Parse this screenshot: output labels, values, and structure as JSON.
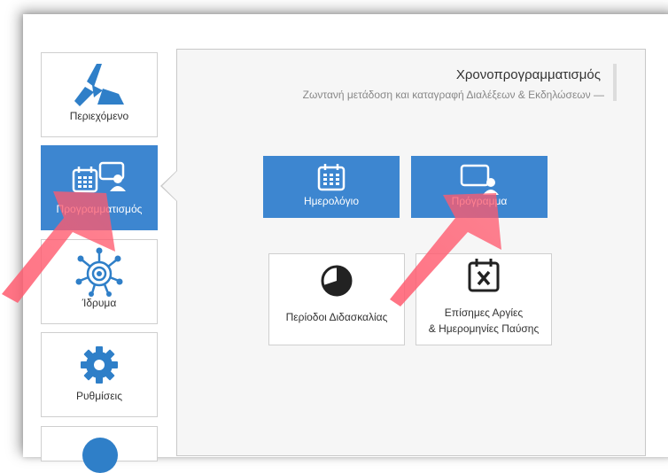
{
  "sidebar": {
    "items": [
      {
        "label": "Περιεχόμενο",
        "icon": "content-triangle-icon"
      },
      {
        "label": "Προγραμματισμός",
        "icon": "scheduling-icon",
        "active": true
      },
      {
        "label": "Ίδρυμα",
        "icon": "institution-network-icon"
      },
      {
        "label": "Ρυθμίσεις",
        "icon": "gear-icon"
      },
      {
        "label": "",
        "icon": "circle-icon"
      }
    ]
  },
  "panel": {
    "title": "Χρονοπρογραμματισμός",
    "subtitle": "Ζωντανή μετάδοση και καταγραφή Διαλέξεων & Εκδηλώσεων —"
  },
  "tiles": {
    "calendar": {
      "label": "Ημερολόγιο",
      "icon": "calendar-icon"
    },
    "program": {
      "label": "Πρόγραμμα",
      "icon": "presenter-screen-icon"
    },
    "periods": {
      "label": "Περίοδοι Διδασκαλίας",
      "icon": "pie-clock-icon"
    },
    "holidays": {
      "line1": "Επίσημες Αργίες",
      "line2": "& Ημερομηνίες Παύσης",
      "icon": "calendar-x-icon"
    }
  },
  "colors": {
    "accent": "#3d86d0",
    "arrow": "#ff5a6e"
  }
}
